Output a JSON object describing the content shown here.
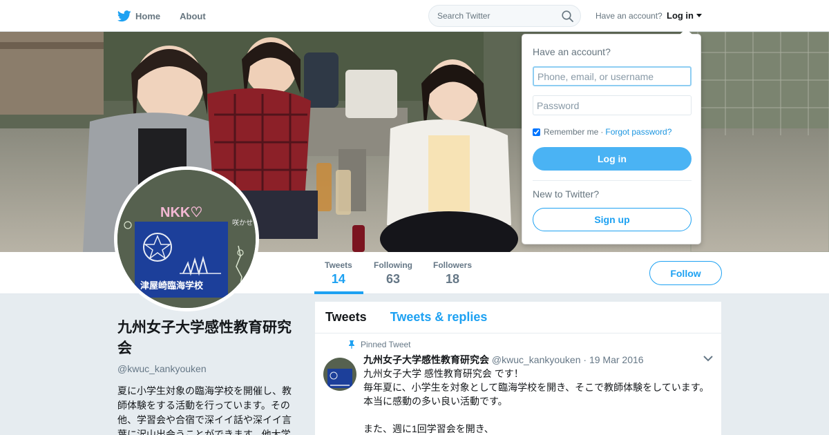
{
  "nav": {
    "home_label": "Home",
    "about_label": "About",
    "search_placeholder": "Search Twitter",
    "account_question": "Have an account?",
    "login_label": "Log in"
  },
  "profile": {
    "name": "九州女子大学感性教育研究会",
    "handle": "@kwuc_kankyouken",
    "bio": "夏に小学生対象の臨海学校を開催し、教師体験をする活動を行っています。その他、学習会や合宿で深イイ話や深イイ言葉に沢山出会うことができます。他大学",
    "avatar_text": {
      "top": "NKK♡",
      "banner": "津屋崎臨海学校",
      "corner": "咲かせ"
    },
    "follow_label": "Follow"
  },
  "stats": [
    {
      "label": "Tweets",
      "value": "14"
    },
    {
      "label": "Following",
      "value": "63"
    },
    {
      "label": "Followers",
      "value": "18"
    }
  ],
  "timeline": {
    "tabs": [
      "Tweets",
      "Tweets & replies"
    ],
    "pinned_label": "Pinned Tweet",
    "tweet": {
      "name": "九州女子大学感性教育研究会",
      "handle": "@kwuc_kankyouken",
      "date": "· 19 Mar 2016",
      "lines": [
        "九州女子大学 感性教育研究会 です！",
        "毎年夏に、小学生を対象として臨海学校を開き、そこで教師体験をしています。",
        "本当に感動の多い良い活動です。",
        "",
        "また、週に1回学習会を開き、"
      ]
    }
  },
  "login_dropdown": {
    "title": "Have an account?",
    "username_placeholder": "Phone, email, or username",
    "password_placeholder": "Password",
    "remember_label": "Remember me",
    "separator": "·",
    "forgot_label": "Forgot password?",
    "login_button": "Log in",
    "new_label": "New to Twitter?",
    "signup_button": "Sign up"
  },
  "colors": {
    "accent": "#1da1f2",
    "login_button": "#4ab3f4",
    "page_background": "#e6ecf0"
  }
}
